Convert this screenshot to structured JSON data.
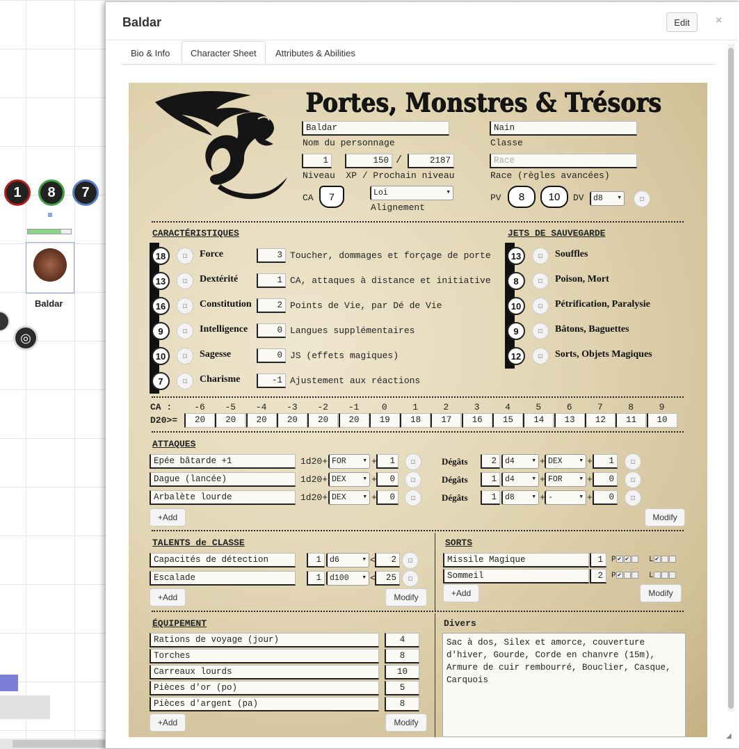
{
  "canvas": {
    "tokens": [
      {
        "label": "1",
        "color": "#b71c1c"
      },
      {
        "label": "8",
        "color": "#43a047"
      },
      {
        "label": "7",
        "color": "#5b7fc7"
      }
    ],
    "character_token_label": "Baldar"
  },
  "dialog": {
    "title": "Baldar",
    "edit_label": "Edit",
    "close_label": "×",
    "tabs": [
      {
        "label": "Bio & Info"
      },
      {
        "label": "Character Sheet"
      },
      {
        "label": "Attributes & Abilities"
      }
    ],
    "active_tab": "Character Sheet"
  },
  "sheet": {
    "game_title": "Portes, Monstres & Trésors",
    "name": {
      "value": "Baldar",
      "label": "Nom du personnage"
    },
    "class": {
      "value": "Nain",
      "label": "Classe"
    },
    "level": "1",
    "xp": "150",
    "xp_sep": "/",
    "next_level": "2187",
    "level_label": "Niveau  XP / Prochain niveau",
    "race": {
      "placeholder": "Race",
      "label": "Race (règles avancées)"
    },
    "ca_label": "CA",
    "ca_value": "7",
    "alignment": {
      "value": "Loi",
      "label": "Alignement"
    },
    "pv_label": "PV",
    "pv_current": "8",
    "pv_max": "10",
    "dv_label": "DV",
    "dv_value": "d8",
    "characteristics_header": "CARACTÉRISTIQUES",
    "stats": [
      {
        "score": "18",
        "name": "Force",
        "mod": "3",
        "desc": "Toucher, dommages et forçage de porte"
      },
      {
        "score": "13",
        "name": "Dextérité",
        "mod": "1",
        "desc": "CA, attaques à distance et initiative"
      },
      {
        "score": "16",
        "name": "Constitution",
        "mod": "2",
        "desc": "Points de Vie, par Dé de Vie"
      },
      {
        "score": "9",
        "name": "Intelligence",
        "mod": "0",
        "desc": "Langues supplémentaires"
      },
      {
        "score": "10",
        "name": "Sagesse",
        "mod": "0",
        "desc": "JS (effets magiques)"
      },
      {
        "score": "7",
        "name": "Charisme",
        "mod": "-1",
        "desc": "Ajustement aux réactions"
      }
    ],
    "saves_header": "JETS DE SAUVEGARDE",
    "saves": [
      {
        "value": "13",
        "name": "Souffles"
      },
      {
        "value": "8",
        "name": "Poison, Mort"
      },
      {
        "value": "10",
        "name": "Pétrification, Paralysie"
      },
      {
        "value": "9",
        "name": "Bâtons, Baguettes"
      },
      {
        "value": "12",
        "name": "Sorts, Objets Magiques"
      }
    ],
    "ca_row_label": "CA :",
    "d20_row_label": "D20>=",
    "ca_table": [
      "-6",
      "-5",
      "-4",
      "-3",
      "-2",
      "-1",
      "0",
      "1",
      "2",
      "3",
      "4",
      "5",
      "6",
      "7",
      "8",
      "9"
    ],
    "d20_table": [
      "20",
      "20",
      "20",
      "20",
      "20",
      "20",
      "19",
      "18",
      "17",
      "16",
      "15",
      "14",
      "13",
      "12",
      "11",
      "10"
    ],
    "attacks_header": "ATTAQUES",
    "attacks": [
      {
        "name": "Epée bâtarde +1",
        "roll": "1d20+",
        "stat": "FOR",
        "bonus": "1",
        "dmg_label": "Dégâts",
        "dmg_n": "2",
        "dmg_die": "d4",
        "dmg_stat": "DEX",
        "dmg_bonus": "1"
      },
      {
        "name": "Dague (lancée)",
        "roll": "1d20+",
        "stat": "DEX",
        "bonus": "0",
        "dmg_label": "Dégâts",
        "dmg_n": "1",
        "dmg_die": "d4",
        "dmg_stat": "FOR",
        "dmg_bonus": "0"
      },
      {
        "name": "Arbalète lourde",
        "roll": "1d20+",
        "stat": "DEX",
        "bonus": "0",
        "dmg_label": "Dégâts",
        "dmg_n": "1",
        "dmg_die": "d8",
        "dmg_stat": "-",
        "dmg_bonus": "0"
      }
    ],
    "add_label": "+Add",
    "modify_label": "Modify",
    "plus": "+",
    "lt": "<",
    "talents_header": "TALENTS de CLASSE",
    "talents": [
      {
        "name": "Capacités de détection",
        "n": "1",
        "die": "d6",
        "target": "2"
      },
      {
        "name": "Escalade",
        "n": "1",
        "die": "d100",
        "target": "25"
      }
    ],
    "spells_header": "SORTS",
    "spells": [
      {
        "name": "Missile Magique",
        "level": "1",
        "p_label": "P",
        "l_label": "L",
        "p_checks": [
          true,
          true,
          false
        ],
        "l_checks": [
          true,
          false,
          false
        ]
      },
      {
        "name": "Sommeil",
        "level": "2",
        "p_label": "P",
        "l_label": "L",
        "p_checks": [
          true,
          false,
          false
        ],
        "l_checks": [
          false,
          false,
          false
        ]
      }
    ],
    "equipment_header": "ÉQUIPEMENT",
    "equipment": [
      {
        "name": "Rations de voyage (jour)",
        "qty": "4"
      },
      {
        "name": "Torches",
        "qty": "8"
      },
      {
        "name": "Carreaux lourds",
        "qty": "10"
      },
      {
        "name": "Pièces d'or (po)",
        "qty": "5"
      },
      {
        "name": "Pièces d'argent (pa)",
        "qty": "8"
      }
    ],
    "misc_header": "Divers",
    "misc_text": "Sac à dos, Silex et amorce, couverture d'hiver, Gourde, Corde en chanvre (15m), Armure de cuir rembourré, Bouclier, Casque, Carquois"
  }
}
